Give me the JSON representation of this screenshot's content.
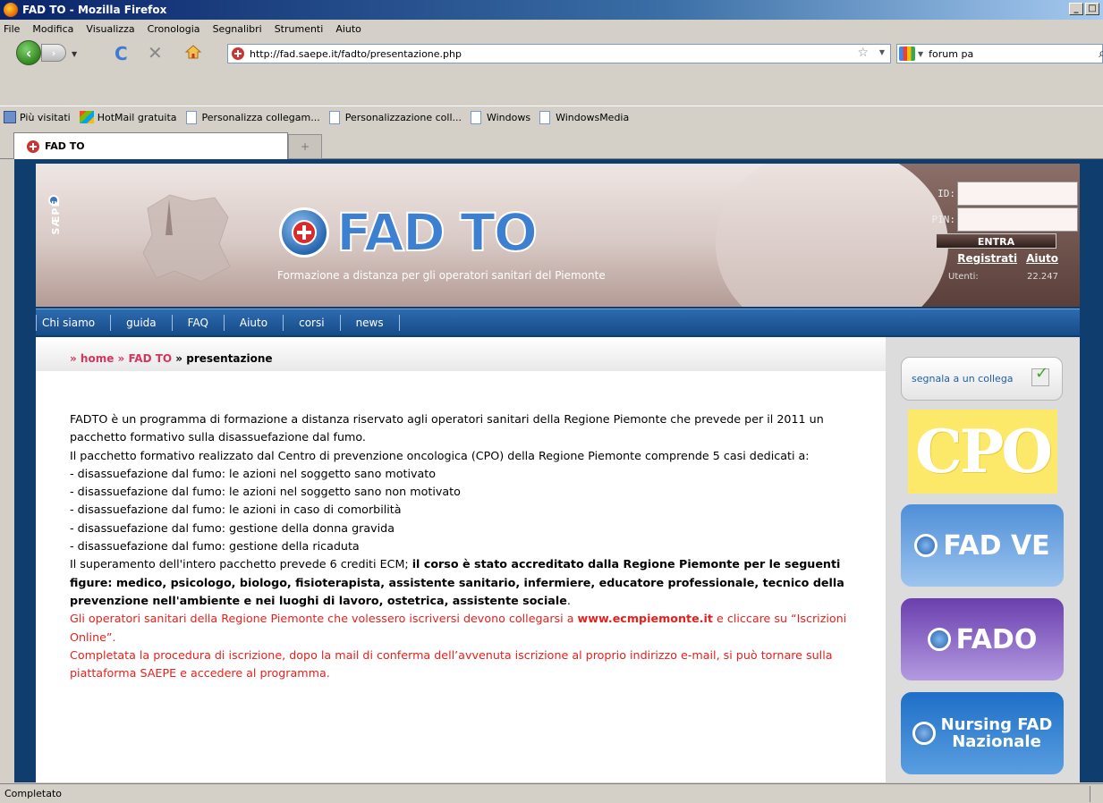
{
  "window": {
    "title": "FAD TO - Mozilla Firefox"
  },
  "menu": [
    "File",
    "Modifica",
    "Visualizza",
    "Cronologia",
    "Segnalibri",
    "Strumenti",
    "Aiuto"
  ],
  "toolbar": {
    "url": "http://fad.saepe.it/fadto/presentazione.php",
    "search_value": "forum pa"
  },
  "bookmarks": [
    "Più visitati",
    "HotMail gratuita",
    "Personalizza collegam...",
    "Personalizzazione coll...",
    "Windows",
    "WindowsMedia"
  ],
  "tab": {
    "title": "FAD TO",
    "new_tab": "+"
  },
  "header": {
    "brand_vertical": "SÆPE",
    "logo": "FAD TO",
    "tagline": "Formazione a distanza per gli operatori sanitari del Piemonte",
    "login": {
      "id_label": "ID:",
      "pin_label": "PIN:",
      "submit": "ENTRA",
      "register": "Registrati",
      "help": "Aiuto",
      "users_label": "Utenti:",
      "users_count": "22.247"
    }
  },
  "nav": [
    "Chi siamo",
    "guida",
    "FAQ",
    "Aiuto",
    "corsi",
    "news"
  ],
  "breadcrumb": {
    "home": "» home",
    "section": "» FAD TO",
    "current": "» presentazione"
  },
  "content": {
    "p1": "FADTO è un programma di formazione a distanza riservato agli operatori sanitari della Regione Piemonte che prevede per il 2011 un pacchetto formativo sulla disassuefazione dal fumo.",
    "p2": "Il pacchetto formativo realizzato dal Centro di prevenzione oncologica (CPO) della Regione Piemonte comprende 5 casi dedicati a:",
    "items": [
      "- disassuefazione dal fumo: le azioni nel soggetto sano motivato",
      "- disassuefazione dal fumo: le azioni nel soggetto sano non motivato",
      "- disassuefazione dal fumo: le azioni in caso di comorbilità",
      "- disassuefazione dal fumo: gestione della donna gravida",
      "- disassuefazione dal fumo: gestione della ricaduta"
    ],
    "p3_plain": "Il superamento dell'intero pacchetto prevede 6 crediti ECM; ",
    "p3_bold": "il corso è stato accreditato dalla Regione Piemonte per le seguenti figure: medico, psicologo, biologo, fisioterapista, assistente sanitario, infermiere, educatore professionale, tecnico della prevenzione nell'ambiente e nei luoghi di lavoro, ostetrica, assistente sociale",
    "p3_end": ".",
    "p4_a": "Gli operatori sanitari della Regione Piemonte che volessero iscriversi devono collegarsi a ",
    "p4_link": "www.ecmpiemonte.it",
    "p4_b": " e cliccare su “Iscrizioni Online”.",
    "p5": "Completata la procedura di iscrizione, dopo la mail di conferma dell’avvenuta iscrizione al proprio indirizzo e-mail, si può tornare sulla piattaforma SAEPE e accedere al programma."
  },
  "sidebar": {
    "segnala": "segnala a un collega",
    "cpo": "CPO",
    "fadve": "FAD VE",
    "fado": "FADO",
    "nursing_1": "Nursing FAD",
    "nursing_2": "Nazionale"
  },
  "status": "Completato"
}
